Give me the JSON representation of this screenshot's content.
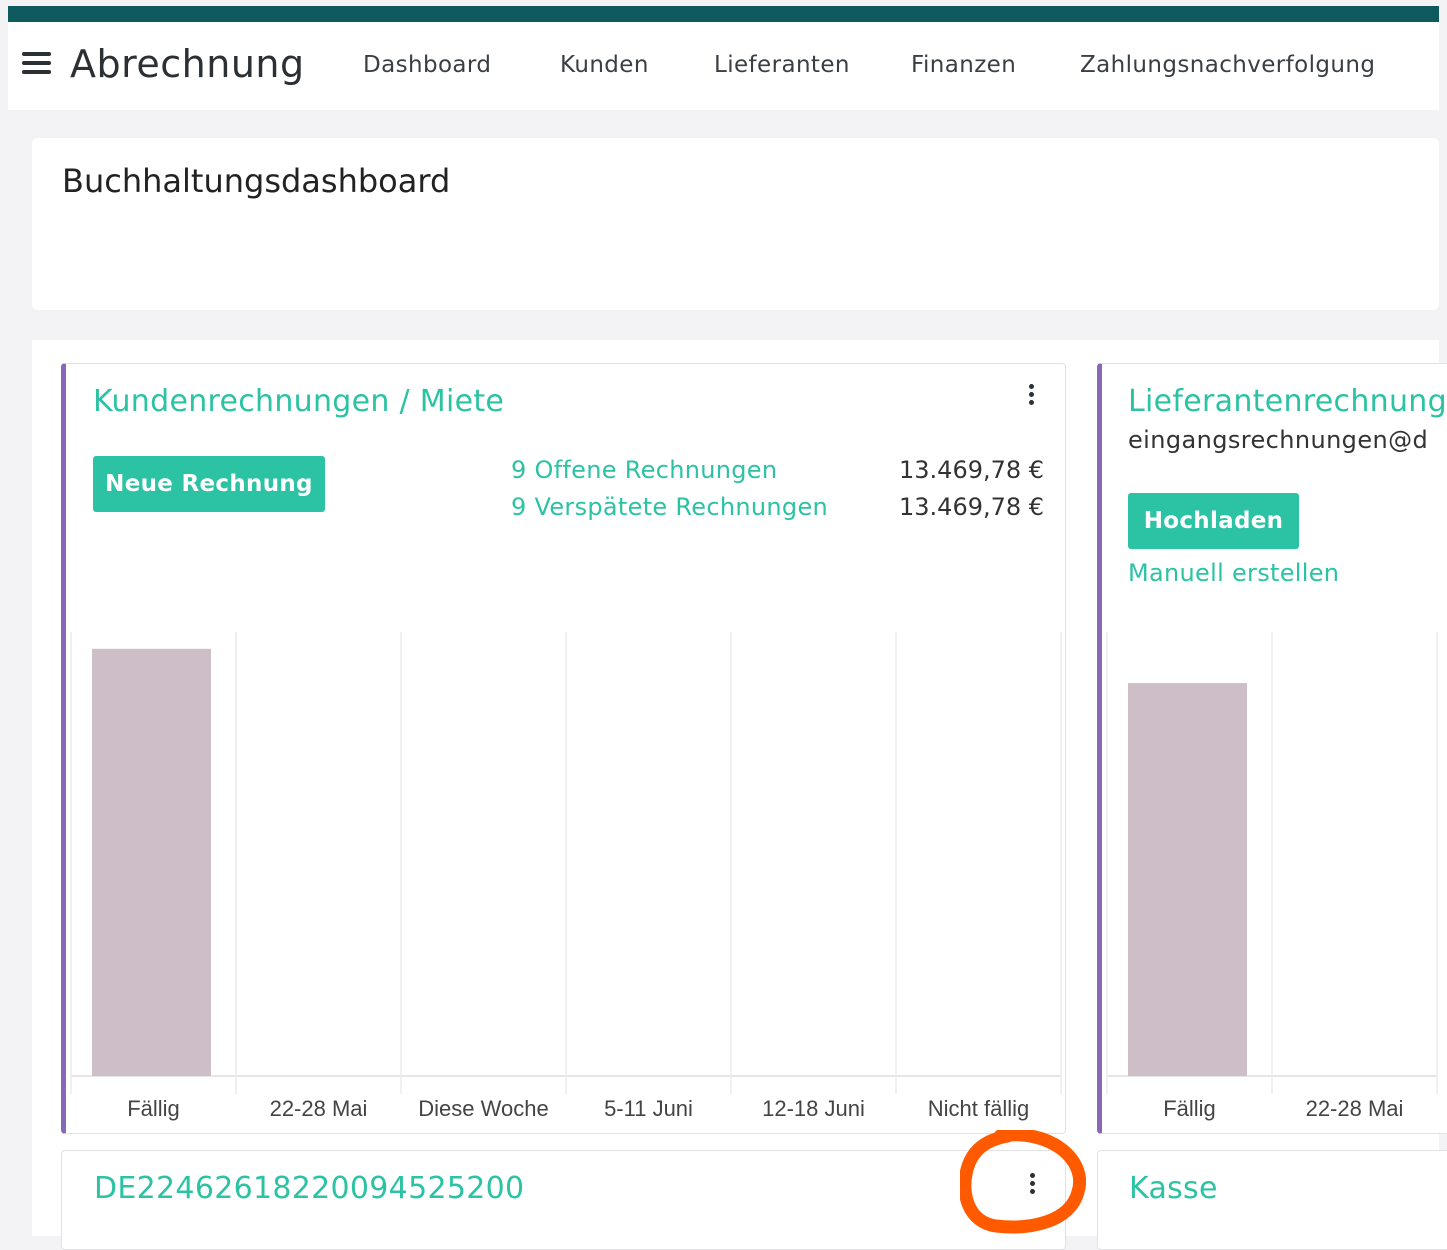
{
  "app": {
    "title": "Abrechnung"
  },
  "nav": {
    "items": [
      "Dashboard",
      "Kunden",
      "Lieferanten",
      "Finanzen",
      "Zahlungsnachverfolgung"
    ]
  },
  "page": {
    "title": "Buchhaltungsdashboard"
  },
  "colors": {
    "accent": "#2cc2a4",
    "purple": "#8a68b8",
    "bar": "#cdbec8",
    "header": "#0e5a5f",
    "annotation": "#ff5a00"
  },
  "card_customers": {
    "title": "Kundenrechnungen / Miete",
    "button": "Neue Rechnung",
    "stats": [
      {
        "label": "9 Offene Rechnungen",
        "amount": "13.469,78 €"
      },
      {
        "label": "9 Verspätete Rechnungen",
        "amount": "13.469,78 €"
      }
    ]
  },
  "card_suppliers": {
    "title": "Lieferantenrechnung",
    "email": "eingangsrechnungen@d",
    "button": "Hochladen",
    "link": "Manuell erstellen"
  },
  "card_iban": {
    "title": "DE22462618220094525200"
  },
  "card_cash": {
    "title": "Kasse"
  },
  "chart_data": [
    {
      "type": "bar",
      "categories": [
        "Fällig",
        "22-28 Mai",
        "Diese Woche",
        "5-11 Juni",
        "12-18 Juni",
        "Nicht fällig"
      ],
      "values": [
        13469.78,
        0,
        0,
        0,
        0,
        0
      ],
      "ylim": [
        0,
        14000
      ],
      "grid": true
    },
    {
      "type": "bar",
      "categories": [
        "Fällig",
        "22-28 Mai"
      ],
      "values": [
        10000,
        0
      ],
      "ylim": [
        0,
        11300
      ],
      "grid": true
    }
  ]
}
